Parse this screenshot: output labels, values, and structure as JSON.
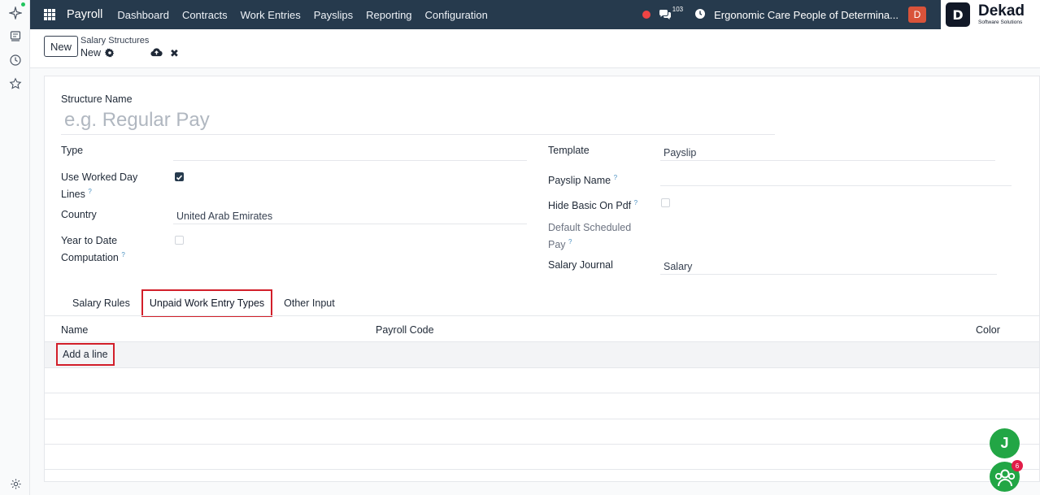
{
  "navbar": {
    "app_name": "Payroll",
    "menu": [
      "Dashboard",
      "Contracts",
      "Work Entries",
      "Payslips",
      "Reporting",
      "Configuration"
    ],
    "chat_count": "103",
    "company": "Ergonomic Care People of Determina...",
    "user_initial": "D",
    "bg_color": "#263a4d"
  },
  "logo": {
    "letter": "D",
    "name": "Dekad",
    "tagline": "Software Solutions"
  },
  "control_panel": {
    "new_button": "New",
    "breadcrumb_parent": "Salary Structures",
    "breadcrumb_current": "New"
  },
  "form": {
    "structure_name_label": "Structure Name",
    "structure_name_placeholder": "e.g. Regular Pay",
    "type_label": "Type",
    "type_value": "",
    "use_worked_day_label_1": "Use Worked Day",
    "use_worked_day_label_2": "Lines",
    "use_worked_day_checked": true,
    "country_label": "Country",
    "country_value": "United Arab Emirates",
    "ytd_label_1": "Year to Date",
    "ytd_label_2": "Computation",
    "ytd_checked": false,
    "template_label": "Template",
    "template_value": "Payslip",
    "payslip_name_label": "Payslip Name",
    "payslip_name_value": "",
    "hide_basic_label": "Hide Basic On Pdf",
    "hide_basic_checked": false,
    "default_sched_label_1": "Default Scheduled",
    "default_sched_label_2": "Pay",
    "salary_journal_label": "Salary Journal",
    "salary_journal_value": "Salary",
    "help_mark": "?"
  },
  "tabs": [
    {
      "label": "Salary Rules",
      "active": false
    },
    {
      "label": "Unpaid Work Entry Types",
      "active": true
    },
    {
      "label": "Other Input",
      "active": false
    }
  ],
  "table": {
    "columns": [
      "Name",
      "Payroll Code",
      "Color"
    ],
    "add_line": "Add a line"
  },
  "floating": {
    "user_initial": "J",
    "chat_badge": "6"
  },
  "colors": {
    "highlight": "#d21f2a",
    "accent_green": "#22a645",
    "badge": "#e11d48"
  }
}
